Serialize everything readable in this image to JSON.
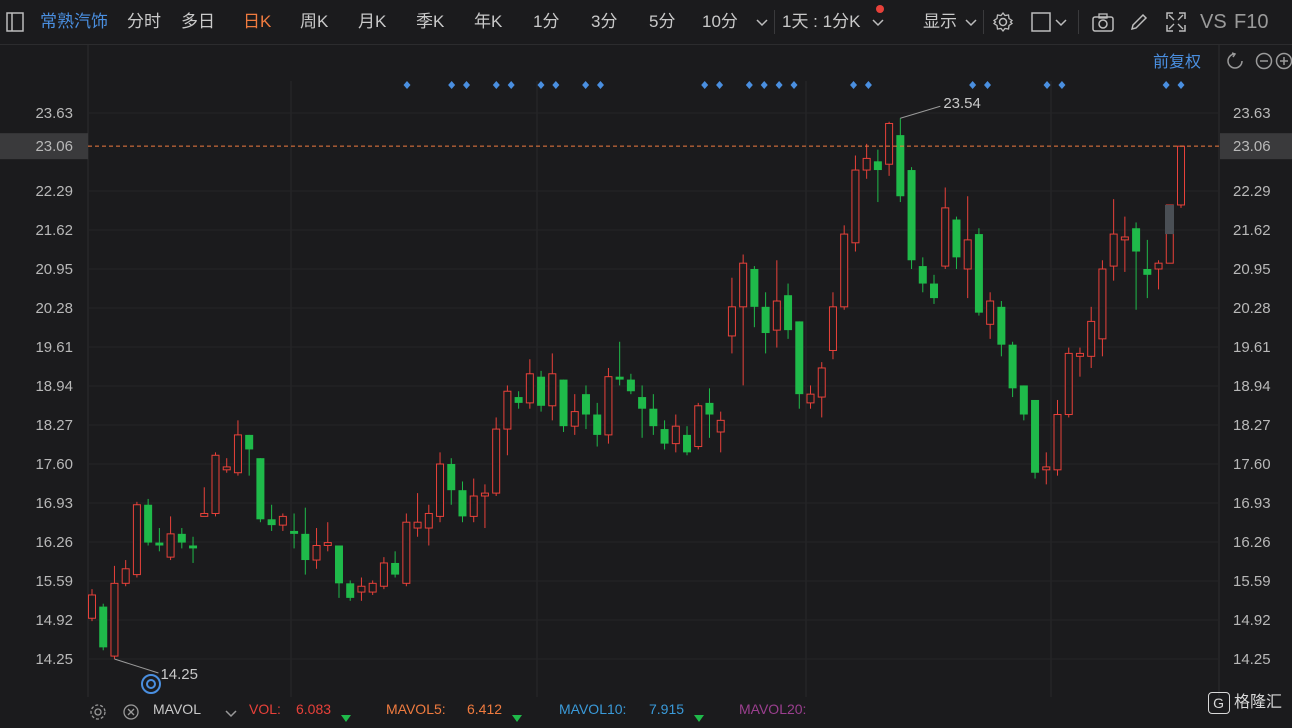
{
  "toolbar": {
    "stock_name": "常熟汽饰",
    "periods": [
      "分时",
      "多日",
      "日K",
      "周K",
      "月K",
      "季K",
      "年K",
      "1分",
      "3分",
      "5分",
      "10分"
    ],
    "active_period": "日K",
    "multi_period": "1天 : 1分K",
    "display_label": "显示",
    "vs_label": "VS",
    "f10_label": "F10",
    "fq_label": "前复权"
  },
  "price_axis": {
    "ticks": [
      "23.63",
      "23.06",
      "22.29",
      "21.62",
      "20.95",
      "20.28",
      "19.61",
      "18.94",
      "18.27",
      "17.60",
      "16.93",
      "16.26",
      "15.59",
      "14.92",
      "14.25"
    ],
    "current_price": "23.06"
  },
  "annotations": {
    "high_label": "23.54",
    "low_label": "14.25"
  },
  "indicator_bar": {
    "name": "MAVOL",
    "vol_label": "VOL:",
    "vol_value": "6.083",
    "mavol5_label": "MAVOL5:",
    "mavol5_value": "6.412",
    "mavol10_label": "MAVOL10:",
    "mavol10_value": "7.915",
    "mavol20_label": "MAVOL20:"
  },
  "logo": "格隆汇",
  "colors": {
    "up": "#e8413a",
    "down": "#1fba4a",
    "accent": "#f07b3f",
    "link": "#4a8fe0",
    "marker": "#4a8fe0"
  },
  "chart_data": {
    "type": "candlestick",
    "ylim": [
      13.9,
      24.0
    ],
    "candles": [
      {
        "o": 14.95,
        "c": 15.35,
        "h": 15.45,
        "l": 14.9
      },
      {
        "o": 15.15,
        "c": 14.45,
        "h": 15.2,
        "l": 14.4
      },
      {
        "o": 14.3,
        "c": 15.55,
        "h": 15.85,
        "l": 14.25
      },
      {
        "o": 15.55,
        "c": 15.8,
        "h": 15.95,
        "l": 15.5
      },
      {
        "o": 15.7,
        "c": 16.9,
        "h": 16.95,
        "l": 15.65
      },
      {
        "o": 16.9,
        "c": 16.25,
        "h": 17.0,
        "l": 16.2
      },
      {
        "o": 16.25,
        "c": 16.2,
        "h": 16.5,
        "l": 16.1
      },
      {
        "o": 16.0,
        "c": 16.4,
        "h": 16.7,
        "l": 15.95
      },
      {
        "o": 16.4,
        "c": 16.25,
        "h": 16.5,
        "l": 16.15
      },
      {
        "o": 16.2,
        "c": 16.15,
        "h": 16.35,
        "l": 15.9
      },
      {
        "o": 16.7,
        "c": 16.75,
        "h": 17.2,
        "l": 16.7
      },
      {
        "o": 16.75,
        "c": 17.75,
        "h": 17.8,
        "l": 16.7
      },
      {
        "o": 17.5,
        "c": 17.55,
        "h": 17.7,
        "l": 17.45
      },
      {
        "o": 17.45,
        "c": 18.1,
        "h": 18.35,
        "l": 17.4
      },
      {
        "o": 18.1,
        "c": 17.85,
        "h": 18.1,
        "l": 17.4
      },
      {
        "o": 17.7,
        "c": 16.65,
        "h": 17.7,
        "l": 16.6
      },
      {
        "o": 16.65,
        "c": 16.55,
        "h": 16.9,
        "l": 16.45
      },
      {
        "o": 16.55,
        "c": 16.7,
        "h": 16.75,
        "l": 16.45
      },
      {
        "o": 16.45,
        "c": 16.4,
        "h": 16.75,
        "l": 16.15
      },
      {
        "o": 16.4,
        "c": 15.95,
        "h": 16.85,
        "l": 15.7
      },
      {
        "o": 15.95,
        "c": 16.2,
        "h": 16.5,
        "l": 15.8
      },
      {
        "o": 16.2,
        "c": 16.25,
        "h": 16.6,
        "l": 16.1
      },
      {
        "o": 16.2,
        "c": 15.55,
        "h": 16.2,
        "l": 15.3
      },
      {
        "o": 15.55,
        "c": 15.3,
        "h": 15.6,
        "l": 15.25
      },
      {
        "o": 15.4,
        "c": 15.5,
        "h": 15.65,
        "l": 15.25
      },
      {
        "o": 15.4,
        "c": 15.55,
        "h": 15.6,
        "l": 15.35
      },
      {
        "o": 15.5,
        "c": 15.9,
        "h": 16.0,
        "l": 15.45
      },
      {
        "o": 15.9,
        "c": 15.7,
        "h": 16.1,
        "l": 15.65
      },
      {
        "o": 15.55,
        "c": 16.6,
        "h": 16.75,
        "l": 15.5
      },
      {
        "o": 16.5,
        "c": 16.6,
        "h": 17.1,
        "l": 16.35
      },
      {
        "o": 16.5,
        "c": 16.75,
        "h": 16.9,
        "l": 16.2
      },
      {
        "o": 16.7,
        "c": 17.6,
        "h": 17.8,
        "l": 16.6
      },
      {
        "o": 17.6,
        "c": 17.15,
        "h": 17.7,
        "l": 16.9
      },
      {
        "o": 17.15,
        "c": 16.7,
        "h": 17.3,
        "l": 16.6
      },
      {
        "o": 16.7,
        "c": 17.05,
        "h": 17.35,
        "l": 16.6
      },
      {
        "o": 17.05,
        "c": 17.1,
        "h": 17.25,
        "l": 16.5
      },
      {
        "o": 17.1,
        "c": 18.2,
        "h": 18.4,
        "l": 17.05
      },
      {
        "o": 18.2,
        "c": 18.85,
        "h": 18.95,
        "l": 17.75
      },
      {
        "o": 18.75,
        "c": 18.65,
        "h": 18.85,
        "l": 18.55
      },
      {
        "o": 18.65,
        "c": 19.15,
        "h": 19.4,
        "l": 18.55
      },
      {
        "o": 19.1,
        "c": 18.6,
        "h": 19.2,
        "l": 18.5
      },
      {
        "o": 18.6,
        "c": 19.15,
        "h": 19.5,
        "l": 18.35
      },
      {
        "o": 19.05,
        "c": 18.25,
        "h": 19.05,
        "l": 18.15
      },
      {
        "o": 18.25,
        "c": 18.5,
        "h": 18.8,
        "l": 18.1
      },
      {
        "o": 18.8,
        "c": 18.45,
        "h": 18.95,
        "l": 18.2
      },
      {
        "o": 18.45,
        "c": 18.1,
        "h": 18.65,
        "l": 17.9
      },
      {
        "o": 18.1,
        "c": 19.1,
        "h": 19.25,
        "l": 17.95
      },
      {
        "o": 19.1,
        "c": 19.05,
        "h": 19.7,
        "l": 18.95
      },
      {
        "o": 19.05,
        "c": 18.85,
        "h": 19.15,
        "l": 18.8
      },
      {
        "o": 18.75,
        "c": 18.55,
        "h": 18.95,
        "l": 18.05
      },
      {
        "o": 18.55,
        "c": 18.25,
        "h": 18.8,
        "l": 18.1
      },
      {
        "o": 18.2,
        "c": 17.95,
        "h": 18.35,
        "l": 17.85
      },
      {
        "o": 17.95,
        "c": 18.25,
        "h": 18.45,
        "l": 17.8
      },
      {
        "o": 18.1,
        "c": 17.8,
        "h": 18.25,
        "l": 17.75
      },
      {
        "o": 17.9,
        "c": 18.6,
        "h": 18.65,
        "l": 17.85
      },
      {
        "o": 18.65,
        "c": 18.45,
        "h": 18.9,
        "l": 18.05
      },
      {
        "o": 18.15,
        "c": 18.35,
        "h": 18.5,
        "l": 17.8
      },
      {
        "o": 19.8,
        "c": 20.3,
        "h": 20.8,
        "l": 19.5
      },
      {
        "o": 20.3,
        "c": 21.05,
        "h": 21.2,
        "l": 18.95
      },
      {
        "o": 20.95,
        "c": 20.3,
        "h": 21.0,
        "l": 19.95
      },
      {
        "o": 20.3,
        "c": 19.85,
        "h": 20.55,
        "l": 19.5
      },
      {
        "o": 19.9,
        "c": 20.4,
        "h": 21.1,
        "l": 19.6
      },
      {
        "o": 20.5,
        "c": 19.9,
        "h": 20.7,
        "l": 19.75
      },
      {
        "o": 20.05,
        "c": 18.8,
        "h": 20.05,
        "l": 18.55
      },
      {
        "o": 18.65,
        "c": 18.8,
        "h": 18.95,
        "l": 18.55
      },
      {
        "o": 18.75,
        "c": 19.25,
        "h": 19.35,
        "l": 18.4
      },
      {
        "o": 19.55,
        "c": 20.3,
        "h": 20.55,
        "l": 19.4
      },
      {
        "o": 20.3,
        "c": 21.55,
        "h": 21.7,
        "l": 20.25
      },
      {
        "o": 21.4,
        "c": 22.65,
        "h": 22.9,
        "l": 21.25
      },
      {
        "o": 22.65,
        "c": 22.85,
        "h": 23.1,
        "l": 22.5
      },
      {
        "o": 22.8,
        "c": 22.65,
        "h": 23.0,
        "l": 22.1
      },
      {
        "o": 22.75,
        "c": 23.45,
        "h": 23.48,
        "l": 22.55
      },
      {
        "o": 23.25,
        "c": 22.2,
        "h": 23.54,
        "l": 22.1
      },
      {
        "o": 22.65,
        "c": 21.1,
        "h": 22.7,
        "l": 20.95
      },
      {
        "o": 21.0,
        "c": 20.7,
        "h": 21.15,
        "l": 20.55
      },
      {
        "o": 20.7,
        "c": 20.45,
        "h": 20.85,
        "l": 20.35
      },
      {
        "o": 21.0,
        "c": 22.0,
        "h": 22.35,
        "l": 20.95
      },
      {
        "o": 21.8,
        "c": 21.15,
        "h": 21.85,
        "l": 20.95
      },
      {
        "o": 20.95,
        "c": 21.45,
        "h": 22.2,
        "l": 20.45
      },
      {
        "o": 21.55,
        "c": 20.2,
        "h": 21.65,
        "l": 20.15
      },
      {
        "o": 20.0,
        "c": 20.4,
        "h": 20.55,
        "l": 19.75
      },
      {
        "o": 20.3,
        "c": 19.65,
        "h": 20.4,
        "l": 19.45
      },
      {
        "o": 19.65,
        "c": 18.9,
        "h": 19.7,
        "l": 18.75
      },
      {
        "o": 18.95,
        "c": 18.45,
        "h": 18.95,
        "l": 18.35
      },
      {
        "o": 18.7,
        "c": 17.45,
        "h": 18.7,
        "l": 17.35
      },
      {
        "o": 17.5,
        "c": 17.55,
        "h": 17.8,
        "l": 17.25
      },
      {
        "o": 17.5,
        "c": 18.45,
        "h": 18.7,
        "l": 17.4
      },
      {
        "o": 18.45,
        "c": 19.5,
        "h": 19.6,
        "l": 18.4
      },
      {
        "o": 19.45,
        "c": 19.5,
        "h": 19.6,
        "l": 19.1
      },
      {
        "o": 19.45,
        "c": 20.05,
        "h": 20.3,
        "l": 19.25
      },
      {
        "o": 19.75,
        "c": 20.95,
        "h": 21.1,
        "l": 19.45
      },
      {
        "o": 21.0,
        "c": 21.55,
        "h": 22.15,
        "l": 20.75
      },
      {
        "o": 21.45,
        "c": 21.5,
        "h": 21.85,
        "l": 20.9
      },
      {
        "o": 21.65,
        "c": 21.25,
        "h": 21.75,
        "l": 20.25
      },
      {
        "o": 20.95,
        "c": 20.85,
        "h": 21.45,
        "l": 20.45
      },
      {
        "o": 20.95,
        "c": 21.05,
        "h": 21.1,
        "l": 20.6
      },
      {
        "o": 21.05,
        "c": 22.05,
        "h": 22.05,
        "l": 21.55
      },
      {
        "o": 22.05,
        "c": 23.06,
        "h": 23.06,
        "l": 22.0
      }
    ],
    "markers_after_index": [
      9,
      12,
      13,
      15,
      16,
      18,
      19,
      22,
      23,
      30,
      31,
      33,
      34,
      35,
      36,
      40,
      41,
      47,
      48,
      53,
      54,
      62,
      63
    ]
  }
}
